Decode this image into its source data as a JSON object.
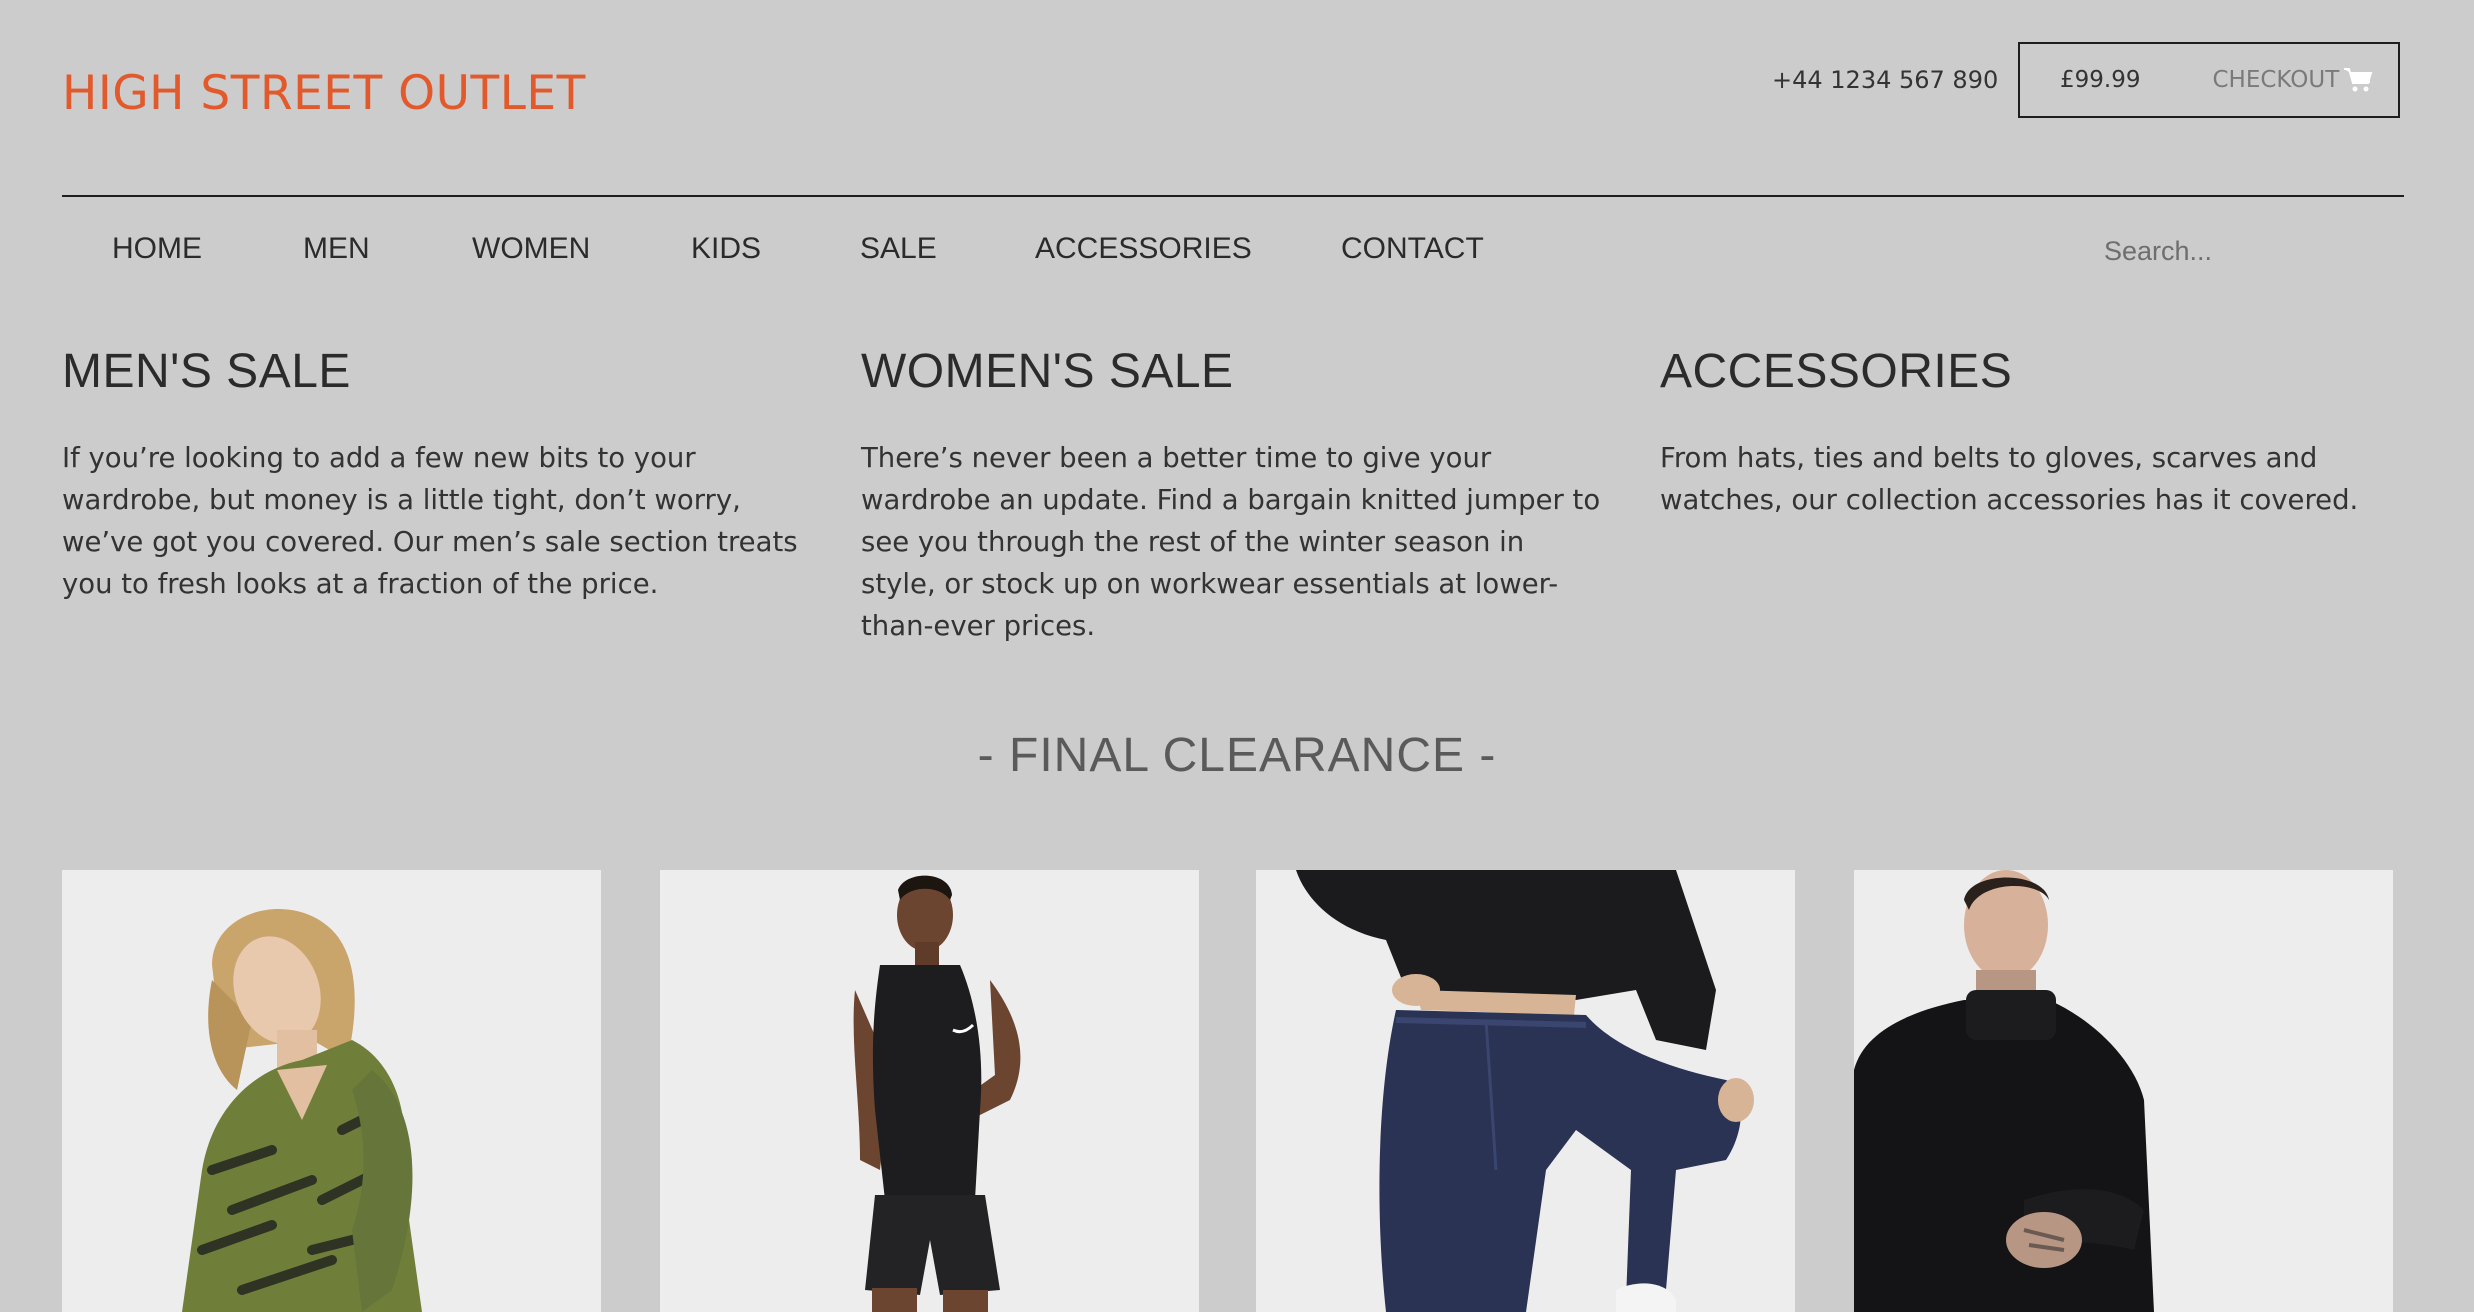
{
  "header": {
    "logo": "HIGH STREET OUTLET",
    "phone": "+44 1234 567 890",
    "cart_total": "£99.99",
    "checkout_label": "CHECKOUT",
    "checkout_icon": "shopping-cart-icon"
  },
  "nav": {
    "items": [
      "HOME",
      "MEN",
      "WOMEN",
      "KIDS",
      "SALE",
      "ACCESSORIES",
      "CONTACT"
    ],
    "search_placeholder": "Search..."
  },
  "sections": [
    {
      "title": "MEN'S SALE",
      "body": "If you’re looking to add a few new bits to your wardrobe, but money is a little tight, don’t worry, we’ve got you covered. Our men’s sale section treats you to fresh looks at a fraction of the price."
    },
    {
      "title": "WOMEN'S SALE",
      "body": "There’s never been a better time to give your wardrobe an update. Find a bargain knitted jumper to see you through the rest of the winter season in style, or stock up on workwear essentials at lower-than-ever prices."
    },
    {
      "title": "ACCESSORIES",
      "body": "From hats, ties and belts to gloves, scarves and watches, our collection accessories has it covered."
    }
  ],
  "clearance": {
    "title": "- FINAL CLEARANCE -"
  },
  "colors": {
    "background": "#cccccc",
    "brand": "#e2592b",
    "text": "#2b2b2b",
    "card": "#eeedee"
  }
}
